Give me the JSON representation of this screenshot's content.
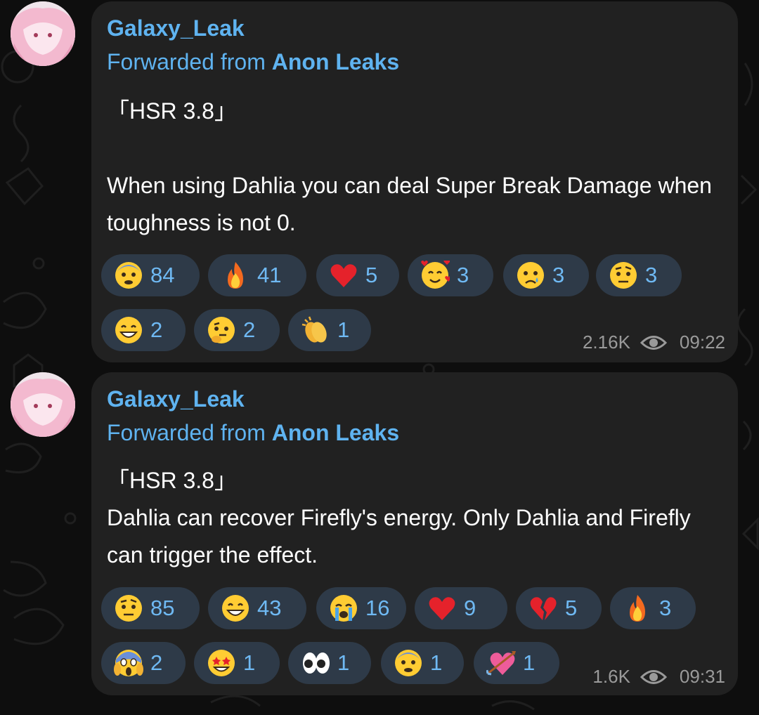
{
  "messages": [
    {
      "sender": "Galaxy_Leak",
      "forwarded_prefix": "Forwarded from ",
      "forwarded_source": "Anon Leaks",
      "text": "「HSR 3.8」\n\nWhen using Dahlia you can deal Super Break Damage when toughness is not 0.",
      "reactions": [
        {
          "emoji": "fearful-face",
          "count": "84"
        },
        {
          "emoji": "fire",
          "count": "41"
        },
        {
          "emoji": "red-heart",
          "count": "5"
        },
        {
          "emoji": "smiling-face-with-hearts",
          "count": "3"
        },
        {
          "emoji": "sad-tear-face",
          "count": "3"
        },
        {
          "emoji": "raised-eyebrow-face",
          "count": "3"
        },
        {
          "emoji": "grinning-face",
          "count": "2"
        },
        {
          "emoji": "thinking-face",
          "count": "2"
        },
        {
          "emoji": "clapping-hands",
          "count": "1"
        }
      ],
      "views": "2.16K",
      "time": "09:22"
    },
    {
      "sender": "Galaxy_Leak",
      "forwarded_prefix": "Forwarded from ",
      "forwarded_source": "Anon Leaks",
      "text": "「HSR 3.8」\nDahlia can recover Firefly's energy. Only Dahlia and Firefly can trigger the effect.",
      "reactions": [
        {
          "emoji": "raised-eyebrow-face",
          "count": "85"
        },
        {
          "emoji": "grinning-face",
          "count": "43"
        },
        {
          "emoji": "loudly-crying-face",
          "count": "16"
        },
        {
          "emoji": "red-heart",
          "count": "9"
        },
        {
          "emoji": "broken-heart",
          "count": "5"
        },
        {
          "emoji": "fire",
          "count": "3"
        },
        {
          "emoji": "screaming-face",
          "count": "2"
        },
        {
          "emoji": "star-struck",
          "count": "1"
        },
        {
          "emoji": "eyes",
          "count": "1"
        },
        {
          "emoji": "fearful-face",
          "count": "1"
        },
        {
          "emoji": "heart-with-arrow",
          "count": "1"
        }
      ],
      "views": "1.6K",
      "time": "09:31"
    }
  ],
  "colors": {
    "background": "#0e0e0e",
    "bubble": "#212121",
    "accent": "#5fb3f0",
    "reaction_bg": "#2e3a48",
    "meta": "#9a9a9a"
  }
}
